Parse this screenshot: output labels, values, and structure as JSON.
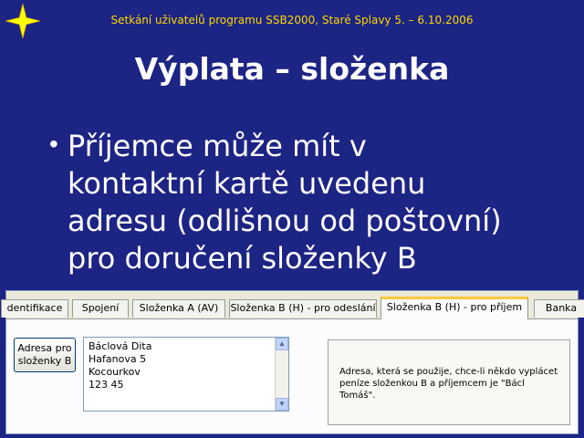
{
  "slide": {
    "header": "Setkání uživatelů programu SSB2000, Staré Splavy 5. – 6.10.2006",
    "title": "Výplata – složenka",
    "bullet": "Příjemce může mít v\nkontaktní kartě uvedenu\nadresu (odlišnou od poštovní)\npro doručení složenky B"
  },
  "dialog": {
    "tabs": [
      {
        "label": "dentifikace"
      },
      {
        "label": "Spojení"
      },
      {
        "label": "Složenka A (AV)"
      },
      {
        "label": "Složenka B (H) - pro odeslání"
      },
      {
        "label": "Složenka B (H) - pro příjem"
      },
      {
        "label": "Banka"
      }
    ],
    "address_button": "Adresa pro\nsloženky B",
    "address_lines": [
      "Báclová Dita",
      "Hafanova 5",
      "Kocourkov",
      "123 45"
    ],
    "info_text": "Adresa, která se použije, chce-li někdo vyplácet peníze složenkou B a příjemcem je \"Bácl Tomáš\"."
  },
  "colors": {
    "background": "#1c2484",
    "header_text": "#ffd700",
    "active_tab_accent": "#ffc83c"
  }
}
